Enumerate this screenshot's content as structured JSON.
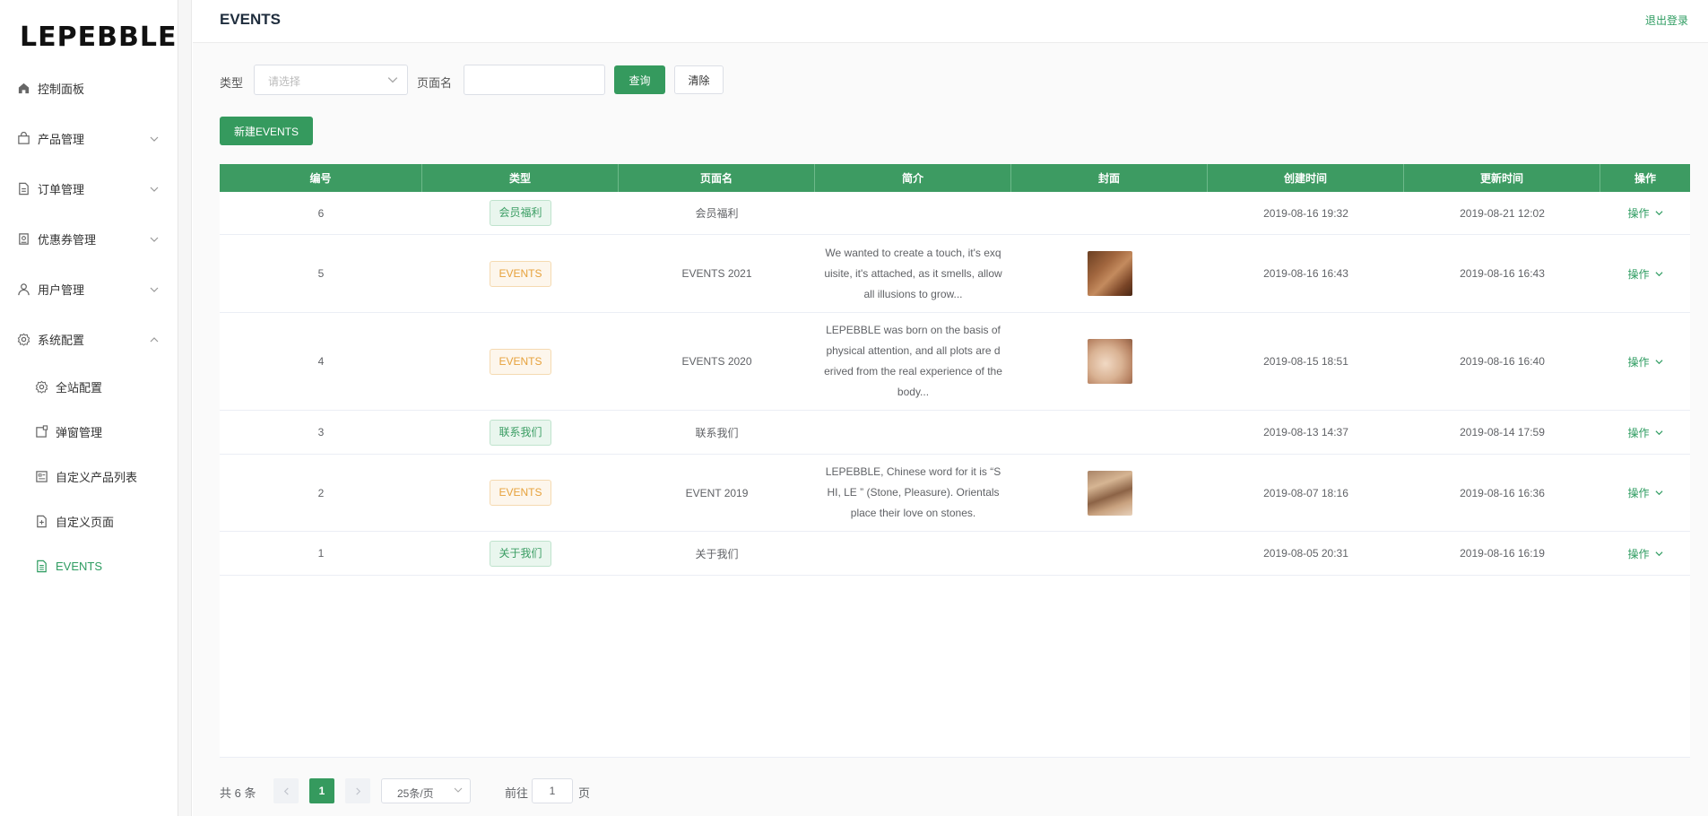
{
  "brand": {
    "logo": "LEPEBBLE"
  },
  "sidebar": {
    "items": [
      {
        "label": "控制面板",
        "icon": "home-icon"
      },
      {
        "label": "产品管理",
        "icon": "bag-icon"
      },
      {
        "label": "订单管理",
        "icon": "document-icon"
      },
      {
        "label": "优惠券管理",
        "icon": "coupon-icon"
      },
      {
        "label": "用户管理",
        "icon": "user-icon"
      },
      {
        "label": "系统配置",
        "icon": "gear-icon"
      }
    ],
    "subitems": [
      {
        "label": "全站配置",
        "icon": "gear-icon"
      },
      {
        "label": "弹窗管理",
        "icon": "popup-icon"
      },
      {
        "label": "自定义产品列表",
        "icon": "list-icon"
      },
      {
        "label": "自定义页面",
        "icon": "add-page-icon"
      },
      {
        "label": "EVENTS",
        "icon": "document-icon",
        "active": true
      }
    ]
  },
  "header": {
    "title": "EVENTS",
    "logout": "退出登录"
  },
  "filters": {
    "type_label": "类型",
    "type_placeholder": "请选择",
    "page_label": "页面名",
    "search_button": "查询",
    "clear_button": "清除",
    "new_button": "新建EVENTS"
  },
  "table": {
    "columns": [
      "编号",
      "类型",
      "页面名",
      "简介",
      "封面",
      "创建时间",
      "更新时间",
      "操作"
    ],
    "rows": [
      {
        "id": "6",
        "type": "会员福利",
        "type_color": "green",
        "page": "会员福利",
        "desc": "",
        "cover": null,
        "created": "2019-08-16 19:32",
        "updated": "2019-08-21 12:02",
        "op": "操作"
      },
      {
        "id": "5",
        "type": "EVENTS",
        "type_color": "orange",
        "page": "EVENTS 2021",
        "desc": "We wanted to create a touch, it's exquisite, it's attached, as it smells, allow all illusions to grow...",
        "cover": "hair-brown",
        "created": "2019-08-16 16:43",
        "updated": "2019-08-16 16:43",
        "op": "操作"
      },
      {
        "id": "4",
        "type": "EVENTS",
        "type_color": "orange",
        "page": "EVENTS 2020",
        "desc": "LEPEBBLE was born on the basis of physical attention, and all plots are derived from the real experience of the body...",
        "cover": "skin-light",
        "created": "2019-08-15 18:51",
        "updated": "2019-08-16 16:40",
        "op": "操作"
      },
      {
        "id": "3",
        "type": "联系我们",
        "type_color": "green",
        "page": "联系我们",
        "desc": "",
        "cover": null,
        "created": "2019-08-13 14:37",
        "updated": "2019-08-14 17:59",
        "op": "操作"
      },
      {
        "id": "2",
        "type": "EVENTS",
        "type_color": "orange",
        "page": "EVENT 2019",
        "desc": "LEPEBBLE, Chinese word for it is “SHI, LE ” (Stone, Pleasure). Orientals place their love on stones.",
        "cover": "hair-light",
        "created": "2019-08-07 18:16",
        "updated": "2019-08-16 16:36",
        "op": "操作"
      },
      {
        "id": "1",
        "type": "关于我们",
        "type_color": "green",
        "page": "关于我们",
        "desc": "",
        "cover": null,
        "created": "2019-08-05 20:31",
        "updated": "2019-08-16 16:19",
        "op": "操作"
      }
    ]
  },
  "pagination": {
    "total_text": "共 6 条",
    "current_page": "1",
    "page_size": "25条/页",
    "goto_label": "前往",
    "goto_value": "1",
    "goto_suffix": "页"
  },
  "colors": {
    "accent": "#359a5e",
    "header_bg": "#3d9b62",
    "tag_orange": "#e6a23c"
  }
}
